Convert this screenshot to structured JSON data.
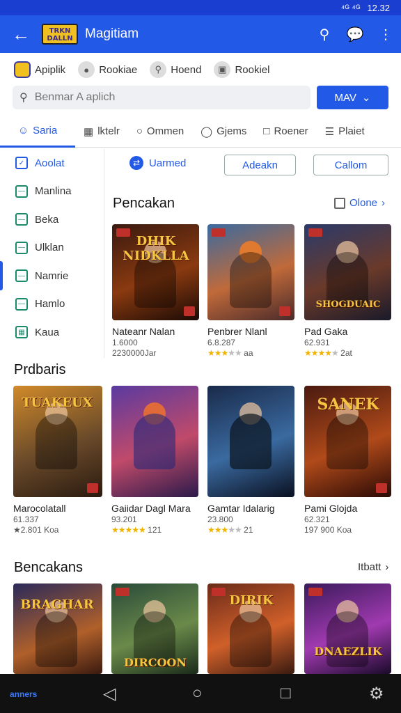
{
  "status": {
    "signal": "⁴ᴳ ⁴ᴳ",
    "time": "12.32"
  },
  "appbar": {
    "title": "Magitiam",
    "logo_text": "TRKN\nDALLN"
  },
  "chips": [
    {
      "label": "Apiplik",
      "icon": "app-icon"
    },
    {
      "label": "Rookiae",
      "icon": "person-icon"
    },
    {
      "label": "Hoend",
      "icon": "search-icon"
    },
    {
      "label": "Rookiel",
      "icon": "image-icon"
    }
  ],
  "search": {
    "placeholder": "Benmar A aplich",
    "value": ""
  },
  "main_button": {
    "label": "MAV"
  },
  "tabs": [
    {
      "label": "Saria",
      "icon": "person-icon",
      "active": true
    },
    {
      "label": "lktelr",
      "icon": "grid-icon"
    },
    {
      "label": "Ommen",
      "icon": "circle-icon"
    },
    {
      "label": "Gjems",
      "icon": "gamepad-icon"
    },
    {
      "label": "Roener",
      "icon": "square-icon"
    },
    {
      "label": "Plaiet",
      "icon": "list-icon"
    }
  ],
  "sidebar": [
    {
      "label": "Aoolat",
      "active": true
    },
    {
      "label": "Manlina"
    },
    {
      "label": "Beka"
    },
    {
      "label": "Ulklan"
    },
    {
      "label": "Namrie"
    },
    {
      "label": "Hamlo"
    },
    {
      "label": "Kaua"
    }
  ],
  "filters": {
    "unmarked": "Uarmed",
    "btn1": "Adeakn",
    "btn2": "Callom"
  },
  "sections": {
    "s1": {
      "title": "Pencakan",
      "more": "Olone"
    },
    "s2": {
      "title": "Prdbaris"
    },
    "s3": {
      "title": "Bencakans",
      "more": "Itbatt"
    }
  },
  "cards_row1": [
    {
      "name": "Nateanr Nalan",
      "line1": "1.6000",
      "line2": "2230000Jar",
      "title": "DHIK NIDKLLA",
      "rating": 0
    },
    {
      "name": "Penbrer Nlanl",
      "line1": "6.8.287",
      "line2": "aa",
      "title": "",
      "rating": 3
    },
    {
      "name": "Pad Gaka",
      "line1": "62.931",
      "line2": "2at",
      "title": "SHOGDUAIC",
      "rating": 4
    }
  ],
  "cards_row2": [
    {
      "name": "Marocolatall",
      "line1": "61.337",
      "line2": "★2.801 Koa",
      "title": "TUAKEUX"
    },
    {
      "name": "Gaiidar Dagl Mara",
      "line1": "93.201",
      "line2": "121",
      "title": "",
      "rating": 5
    },
    {
      "name": "Gamtar Idalarig",
      "line1": "23.800",
      "line2": "21",
      "title": "",
      "rating": 3
    },
    {
      "name": "Pami Glojda",
      "line1": "62.321",
      "line2": "197 900 Koa",
      "title": "SANEK"
    }
  ],
  "cards_row3": [
    {
      "title": "BRAGHAR"
    },
    {
      "title": "DIRCOON"
    },
    {
      "title": "DIRIK"
    },
    {
      "title": "DNAEZLIK"
    }
  ],
  "navbar": {
    "label": "anners"
  },
  "colors": {
    "primary": "#2259e6",
    "accent": "#1a8a6a",
    "star": "#f0b400"
  }
}
